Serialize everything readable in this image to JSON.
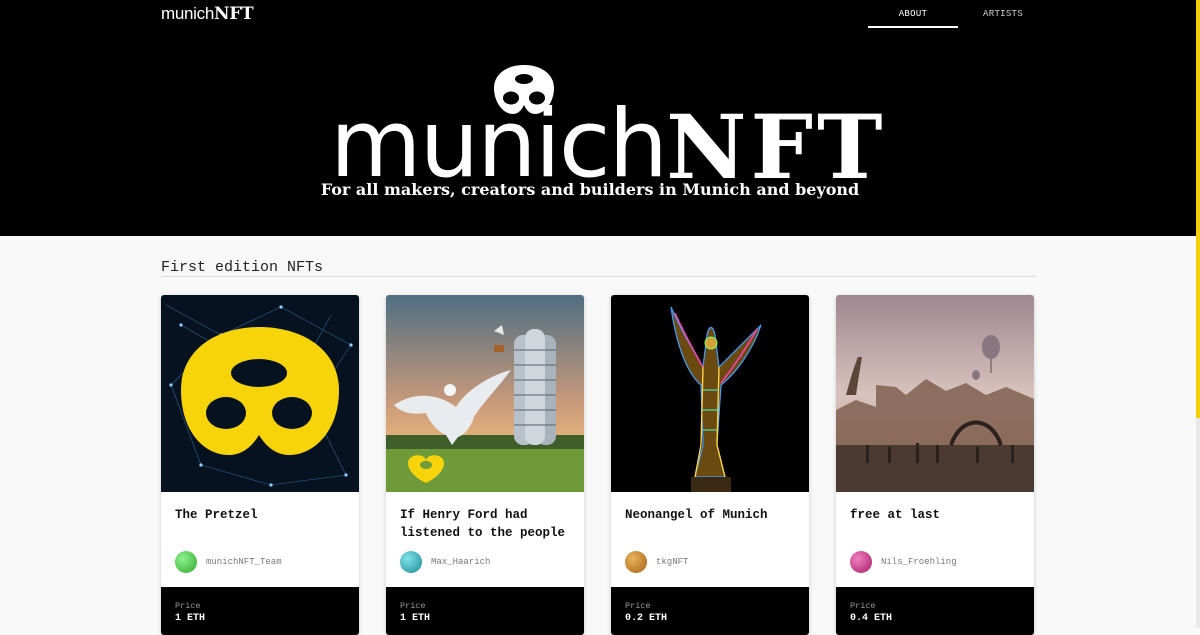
{
  "nav": {
    "logo_light": "munich",
    "logo_heavy": "NFT",
    "links": [
      {
        "label": "ABOUT",
        "active": true
      },
      {
        "label": "ARTISTS",
        "active": false
      }
    ]
  },
  "hero": {
    "title_light": "munich",
    "title_heavy": "NFT",
    "tagline": "For all makers, creators and builders in Munich and beyond",
    "icon": "pretzel-logo-icon"
  },
  "section": {
    "title": "First edition NFTs"
  },
  "price_label": "Price",
  "cards": [
    {
      "title": "The Pretzel",
      "creator": "munichNFT_Team",
      "price": "1 ETH",
      "avatar_color": "#3fc23f",
      "art": "pretzel-artwork"
    },
    {
      "title": "If Henry Ford had listened to the people",
      "creator": "Max_Haarich",
      "price": "1 ETH",
      "avatar_color": "#1aa8b0",
      "art": "pegasus-bmw-tower-artwork"
    },
    {
      "title": "Neonangel of Munich",
      "creator": "tkgNFT",
      "price": "0.2 ETH",
      "avatar_color": "#c27a1f",
      "art": "neon-angel-artwork"
    },
    {
      "title": "free at last",
      "creator": "Nils_Froehling",
      "price": "0.4 ETH",
      "avatar_color": "#c0287a",
      "art": "surreal-city-artwork"
    }
  ],
  "colors": {
    "accent_yellow": "#f2cf0a",
    "hero_bg": "#000000",
    "page_bg": "#f8f8f8"
  }
}
